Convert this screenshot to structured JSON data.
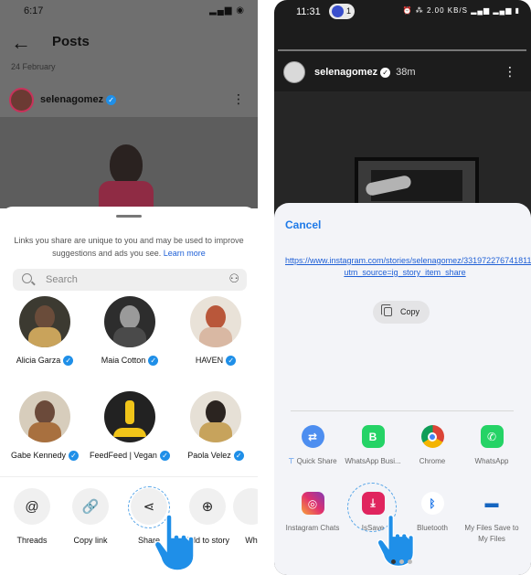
{
  "left_phone": {
    "status": {
      "time": "6:17",
      "icons": "▂▄▆ ◉"
    },
    "header": {
      "back_icon": "←",
      "title": "Posts"
    },
    "date": "24 February",
    "post_user": {
      "name": "selenagomez",
      "verified_mark": "✓",
      "more_icon": "⋮"
    },
    "share_sheet": {
      "info_text": "Links you share are unique to you and may be used to improve suggestions and ads you see.",
      "learn_more": "Learn more",
      "search_placeholder": "Search",
      "add_people_icon": "⚇",
      "contacts": [
        {
          "name": "Alicia Garza",
          "verified": true
        },
        {
          "name": "Maia Cotton",
          "verified": true
        },
        {
          "name": "HAVEN",
          "verified": true
        },
        {
          "name": "Gabe Kennedy",
          "verified": true
        },
        {
          "name": "FeedFeed | Vegan",
          "verified": true
        },
        {
          "name": "Paola Velez",
          "verified": true
        }
      ],
      "actions": [
        {
          "label": "Threads",
          "icon": "@"
        },
        {
          "label": "Copy link",
          "icon": "🔗"
        },
        {
          "label": "Share",
          "icon": "⋖"
        },
        {
          "label": "Add to story",
          "icon": "⊕"
        },
        {
          "label": "Wh",
          "icon": ""
        }
      ]
    }
  },
  "right_phone": {
    "status": {
      "time": "11:31",
      "notif_count": "1",
      "icons": "⏰ ⁂ 2.00 KB/S ▂▄▆ ▂▄▆ ▮"
    },
    "story_user": {
      "name": "selenagomez",
      "verified_mark": "✓",
      "time": "38m",
      "more_icon": "⋮"
    },
    "sheet": {
      "cancel": "Cancel",
      "url": "https://www.instagram.com/stories/selenagomez/3319722767418111105?utm_source=ig_story_item_share",
      "copy": "Copy",
      "apps": [
        {
          "label": "Quick Share",
          "icon": "⇄",
          "pinned": true,
          "color": "#1a73e8"
        },
        {
          "label": "WhatsApp Busi...",
          "icon": "B",
          "pinned": false,
          "color": "#25d366"
        },
        {
          "label": "Chrome",
          "icon": "◉",
          "pinned": false,
          "color": "#db4437"
        },
        {
          "label": "WhatsApp",
          "icon": "✆",
          "pinned": false,
          "color": "#25d366"
        },
        {
          "label": "Instagram Chats",
          "icon": "◎",
          "pinned": false,
          "color": "#d62976"
        },
        {
          "label": "IsSave",
          "icon": "⤓",
          "pinned": false,
          "color": "#e0245e"
        },
        {
          "label": "Bluetooth",
          "icon": "ᛒ",
          "pinned": false,
          "color": "#1a73e8"
        },
        {
          "label": "My Files Save to My Files",
          "icon": "▬",
          "pinned": false,
          "color": "#1565c0"
        }
      ],
      "pin_icon": "📌"
    }
  }
}
